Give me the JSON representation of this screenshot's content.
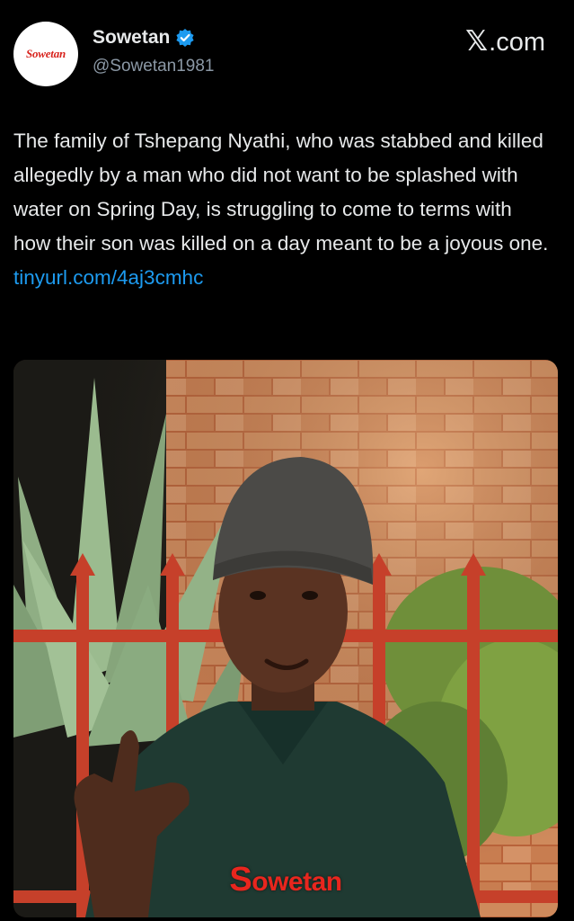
{
  "post": {
    "author": {
      "display_name": "Sowetan",
      "handle": "@Sowetan1981",
      "avatar_logo_text": "Sowetan",
      "verified": true,
      "verified_icon": "verified-badge-icon",
      "verified_color": "#1d9bf0"
    },
    "site_brand": {
      "glyph": "𝕏",
      "domain": ".com"
    },
    "text": {
      "body": "The family of Tshepang Nyathi, who was stabbed and killed allegedly by a man who did not want to be splashed with water on Spring Day, is struggling to come to terms with how their son was killed on a day meant to be a joyous one. ",
      "link": "tinyurl.com/4aj3cmhc"
    },
    "photo": {
      "watermark_first": "S",
      "watermark_rest": "owetan"
    }
  },
  "colors": {
    "background": "#000000",
    "text": "#e7e9ea",
    "secondary_text": "#8b98a5",
    "link": "#1d9bf0",
    "brand_red": "#e8261e"
  }
}
